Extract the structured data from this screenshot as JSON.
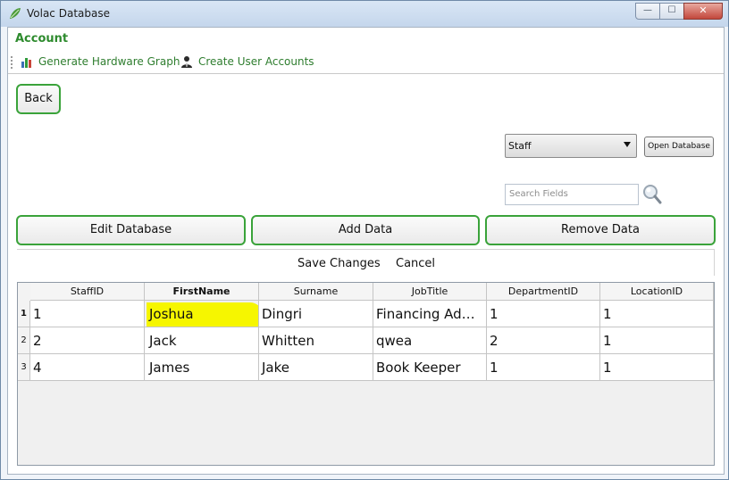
{
  "window": {
    "title": "Volac Database",
    "icon": "volac-leaf-icon",
    "controls": {
      "minimize": "—",
      "maximize": "☐",
      "close": "✕"
    }
  },
  "account_label": "Account",
  "toolbar": {
    "hardware_graph": {
      "label": "Generate Hardware Graph",
      "icon": "bar-chart-icon"
    },
    "create_users": {
      "label": "Create User Accounts",
      "icon": "user-icon"
    }
  },
  "back_button": "Back",
  "table_select": {
    "value": "Staff"
  },
  "open_database_button": "Open Database",
  "search": {
    "placeholder": "Search Fields",
    "icon": "magnifier-icon"
  },
  "actions": {
    "edit": "Edit Database",
    "add": "Add Data",
    "remove": "Remove Data"
  },
  "save_changes": "Save Changes",
  "cancel": "Cancel",
  "grid": {
    "columns": [
      "StaffID",
      "FirstName",
      "Surname",
      "JobTitle",
      "DepartmentID",
      "LocationID"
    ],
    "row_numbers": [
      "1",
      "2",
      "3"
    ],
    "rows": [
      [
        "1",
        "Joshua",
        "Dingri",
        "Financing Advisor",
        "1",
        "1"
      ],
      [
        "2",
        "Jack",
        "Whitten",
        "qwea",
        "2",
        "1"
      ],
      [
        "4",
        "James",
        "Jake",
        "Book Keeper",
        "1",
        "1"
      ]
    ]
  },
  "colors": {
    "accent_green": "#3aa33a",
    "highlight_yellow": "#f6f600"
  }
}
